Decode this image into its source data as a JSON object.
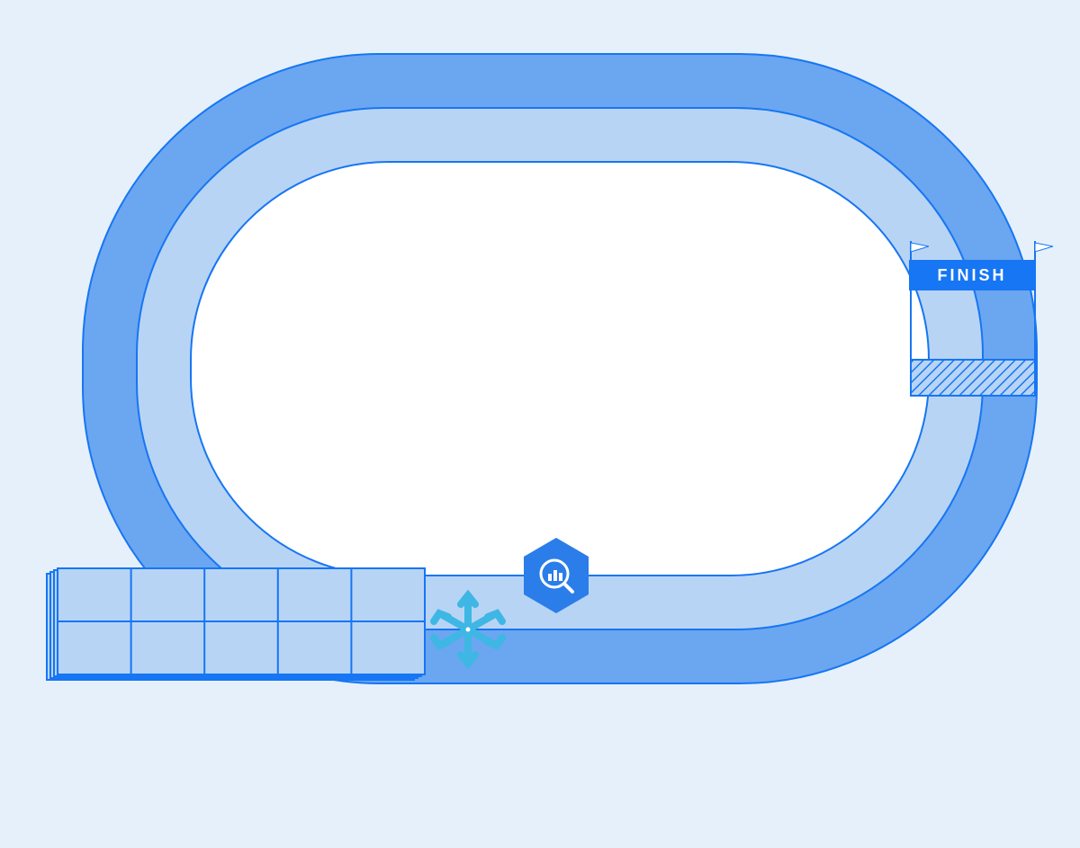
{
  "diagram": {
    "finish_label": "FINISH",
    "colors": {
      "background": "#e6f0fa",
      "track_outer": "#6ba6f0",
      "track_inner_light": "#b8d4f5",
      "stroke": "#1676f3",
      "banner": "#1676f3",
      "snowflake": "#3eb7e4",
      "bigquery_hex": "#2b7de9"
    },
    "icons": {
      "left_lane": "snowflake-icon",
      "right_lane": "bigquery-icon"
    }
  }
}
